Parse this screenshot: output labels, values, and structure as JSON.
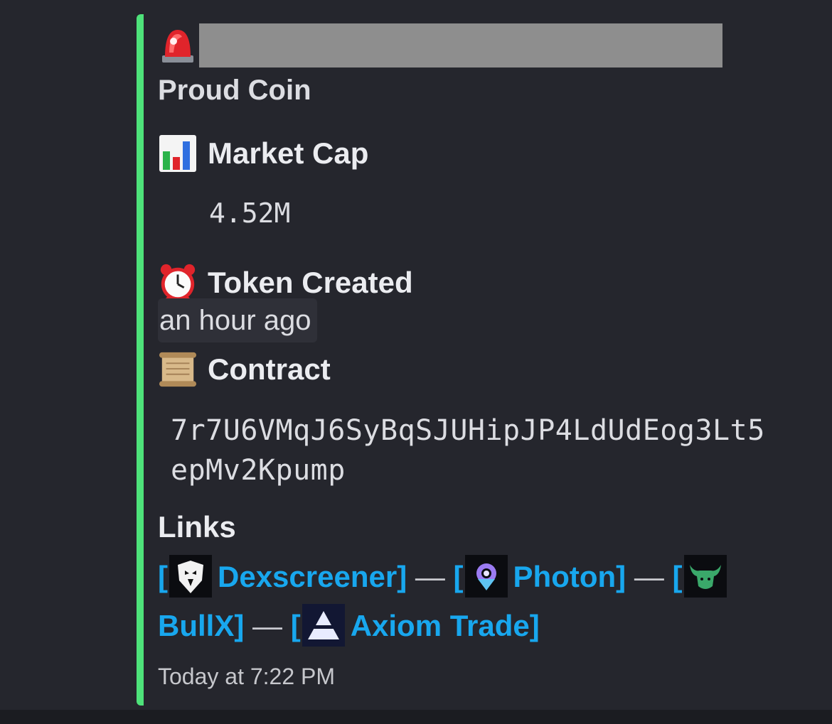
{
  "embed": {
    "accent_color": "#4ee27a",
    "alert_icon": "rotating-light-icon",
    "title": "Proud Coin",
    "fields": {
      "market_cap": {
        "icon": "bar-chart-icon",
        "name": "Market Cap",
        "value": "4.52M"
      },
      "token_created": {
        "icon": "alarm-clock-icon",
        "name": "Token Created",
        "value": "an hour ago"
      },
      "contract": {
        "icon": "scroll-icon",
        "name": "Contract",
        "value": "7r7U6VMqJ6SyBqSJUHipJP4LdUdEog3Lt5epMv2Kpump"
      }
    },
    "links": {
      "title": "Links",
      "bracket_open": "[",
      "bracket_close": "]",
      "separator": " — ",
      "items": [
        {
          "label": "Dexscreener",
          "icon": "eagle-icon"
        },
        {
          "label": "Photon",
          "icon": "photon-icon"
        },
        {
          "label": "BullX",
          "icon": "bull-icon"
        },
        {
          "label": "Axiom Trade",
          "icon": "axiom-icon"
        }
      ]
    },
    "timestamp": "Today at 7:22 PM"
  }
}
